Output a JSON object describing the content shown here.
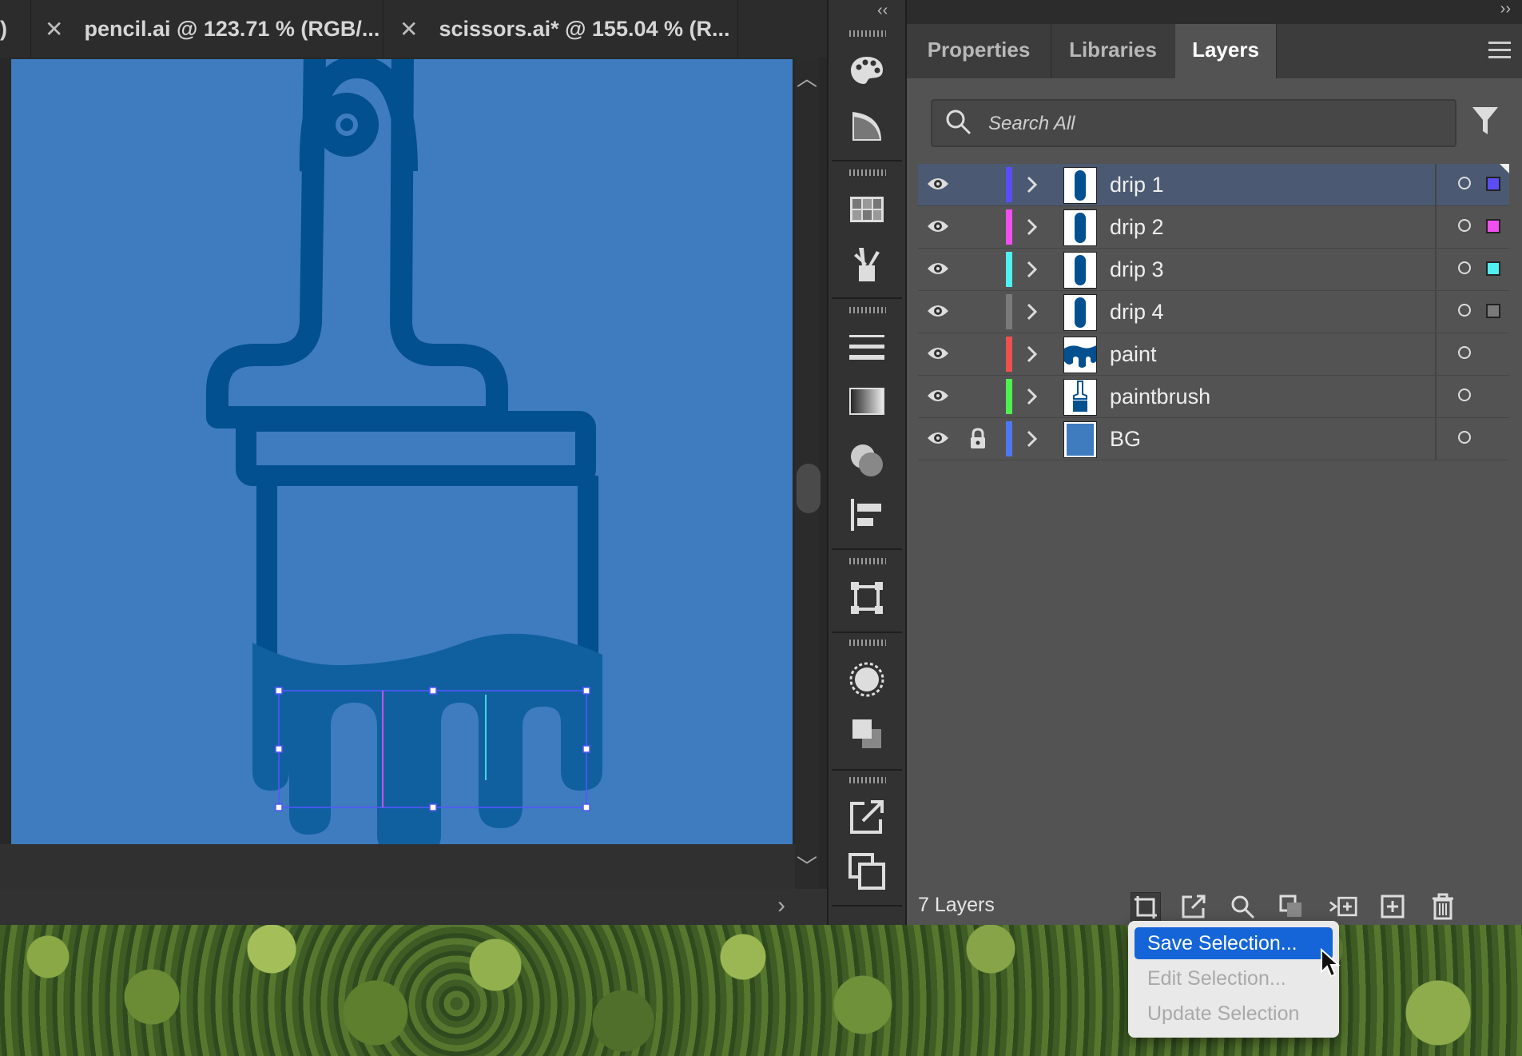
{
  "tabs": {
    "partial_label": ")",
    "items": [
      {
        "close": "✕",
        "title": "pencil.ai @ 123.71 % (RGB/..."
      },
      {
        "close": "✕",
        "title": "scissors.ai* @ 155.04 % (R..."
      }
    ]
  },
  "toolstrip": {
    "collapse_label": "‹‹",
    "icons": [
      "color-palette-icon",
      "color-guide-icon",
      "swatches-icon",
      "brushes-icon",
      "stroke-icon",
      "gradient-icon",
      "transparency-icon",
      "align-icon",
      "transform-icon",
      "appearance-icon",
      "pathfinder-icon",
      "export-icon",
      "artboards-icon"
    ]
  },
  "panel": {
    "expand_label": "››",
    "tabs": [
      "Properties",
      "Libraries",
      "Layers"
    ],
    "active_tab": "Layers",
    "search": {
      "placeholder": "Search All",
      "value": ""
    },
    "layers": [
      {
        "name": "drip 1",
        "color": "#5b4df5",
        "thumb": "drip",
        "selected": true,
        "locked": false,
        "visible": true,
        "has_selection": true
      },
      {
        "name": "drip 2",
        "color": "#f04ff0",
        "thumb": "drip",
        "selected": false,
        "locked": false,
        "visible": true,
        "has_selection": true
      },
      {
        "name": "drip 3",
        "color": "#4ff0f0",
        "thumb": "drip",
        "selected": false,
        "locked": false,
        "visible": true,
        "has_selection": true
      },
      {
        "name": "drip 4",
        "color": "#7a7a7a",
        "thumb": "drip",
        "selected": false,
        "locked": false,
        "visible": true,
        "has_selection": true
      },
      {
        "name": "paint",
        "color": "#f04f4f",
        "thumb": "paint",
        "selected": false,
        "locked": false,
        "visible": true,
        "has_selection": false
      },
      {
        "name": "paintbrush",
        "color": "#4ff04f",
        "thumb": "brush",
        "selected": false,
        "locked": false,
        "visible": true,
        "has_selection": false
      },
      {
        "name": "BG",
        "color": "#4f78f0",
        "thumb": "bg",
        "selected": false,
        "locked": true,
        "visible": true,
        "has_selection": false
      }
    ],
    "layer_count": "7 Layers",
    "bottom_buttons": [
      "collect-for-export-icon",
      "export-selection-icon",
      "locate-object-icon",
      "make-clipping-mask-icon",
      "create-sublayer-icon",
      "create-new-layer-icon",
      "delete-layer-icon"
    ]
  },
  "popup_menu": {
    "items": [
      {
        "label": "Save Selection...",
        "enabled": true,
        "highlighted": true
      },
      {
        "label": "Edit Selection...",
        "enabled": false,
        "highlighted": false
      },
      {
        "label": "Update Selection",
        "enabled": false,
        "highlighted": false
      }
    ]
  },
  "colors": {
    "artboard_bg": "#3e7bbf",
    "brush_stroke": "#02508f",
    "paint_fill": "#1060a0",
    "selection": "#5555ff",
    "menu_highlight": "#1565d8"
  }
}
